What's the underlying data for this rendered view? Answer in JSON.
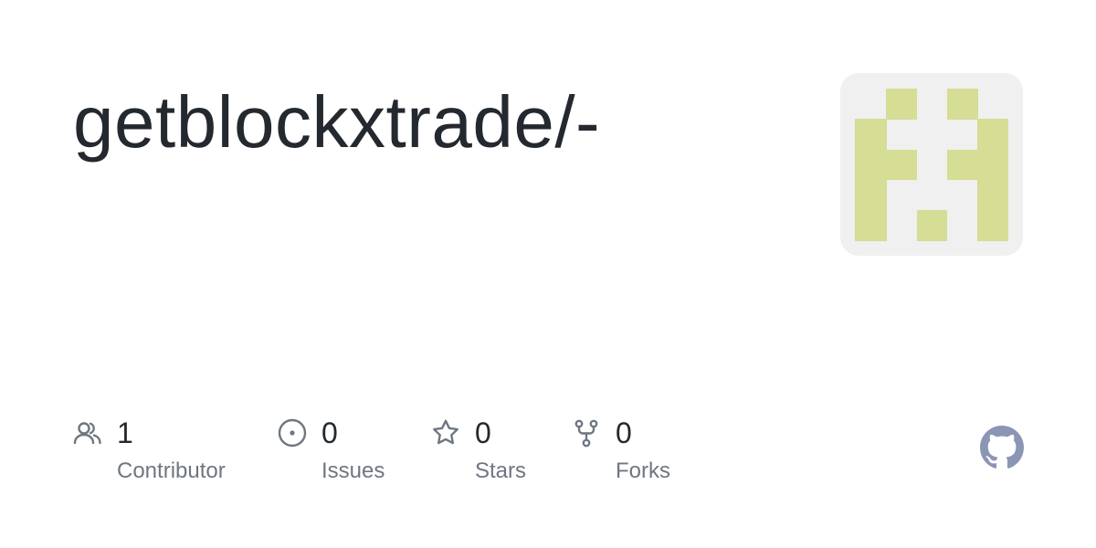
{
  "repo": {
    "full_name": "getblockxtrade/-"
  },
  "identicon": {
    "background": "#f0f0f0",
    "color": "#d6dd94",
    "icon": "identicon-avatar"
  },
  "stats": [
    {
      "icon": "contributors-icon",
      "value": "1",
      "label": "Contributor"
    },
    {
      "icon": "issues-icon",
      "value": "0",
      "label": "Issues"
    },
    {
      "icon": "star-icon",
      "value": "0",
      "label": "Stars"
    },
    {
      "icon": "fork-icon",
      "value": "0",
      "label": "Forks"
    }
  ],
  "colors": {
    "title": "#24292f",
    "label": "#6e7781",
    "icon": "#6e7781",
    "github_logo": "#8b95b4"
  },
  "footer": {
    "logo": "github-logo-icon"
  }
}
